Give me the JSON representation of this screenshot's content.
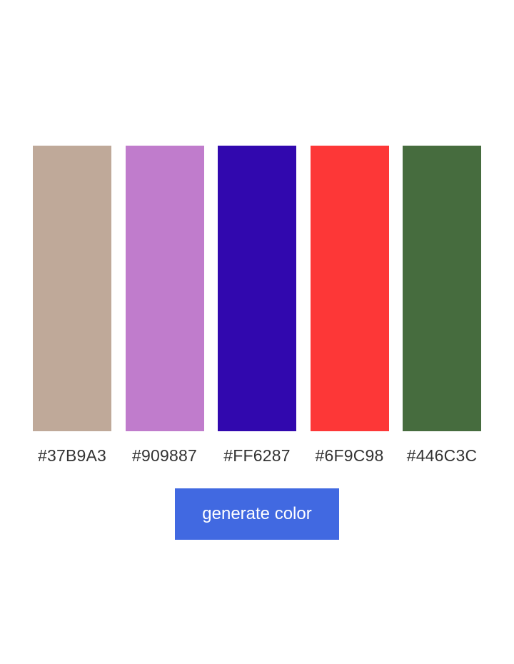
{
  "palette": {
    "swatches": [
      {
        "label": "#37B9A3",
        "color": "#bfa999"
      },
      {
        "label": "#909887",
        "color": "#c07ccc"
      },
      {
        "label": "#FF6287",
        "color": "#3108ae"
      },
      {
        "label": "#6F9C98",
        "color": "#fd3737"
      },
      {
        "label": "#446C3C",
        "color": "#466c3e"
      }
    ]
  },
  "actions": {
    "generate_label": "generate color",
    "button_color": "#4169e1"
  }
}
